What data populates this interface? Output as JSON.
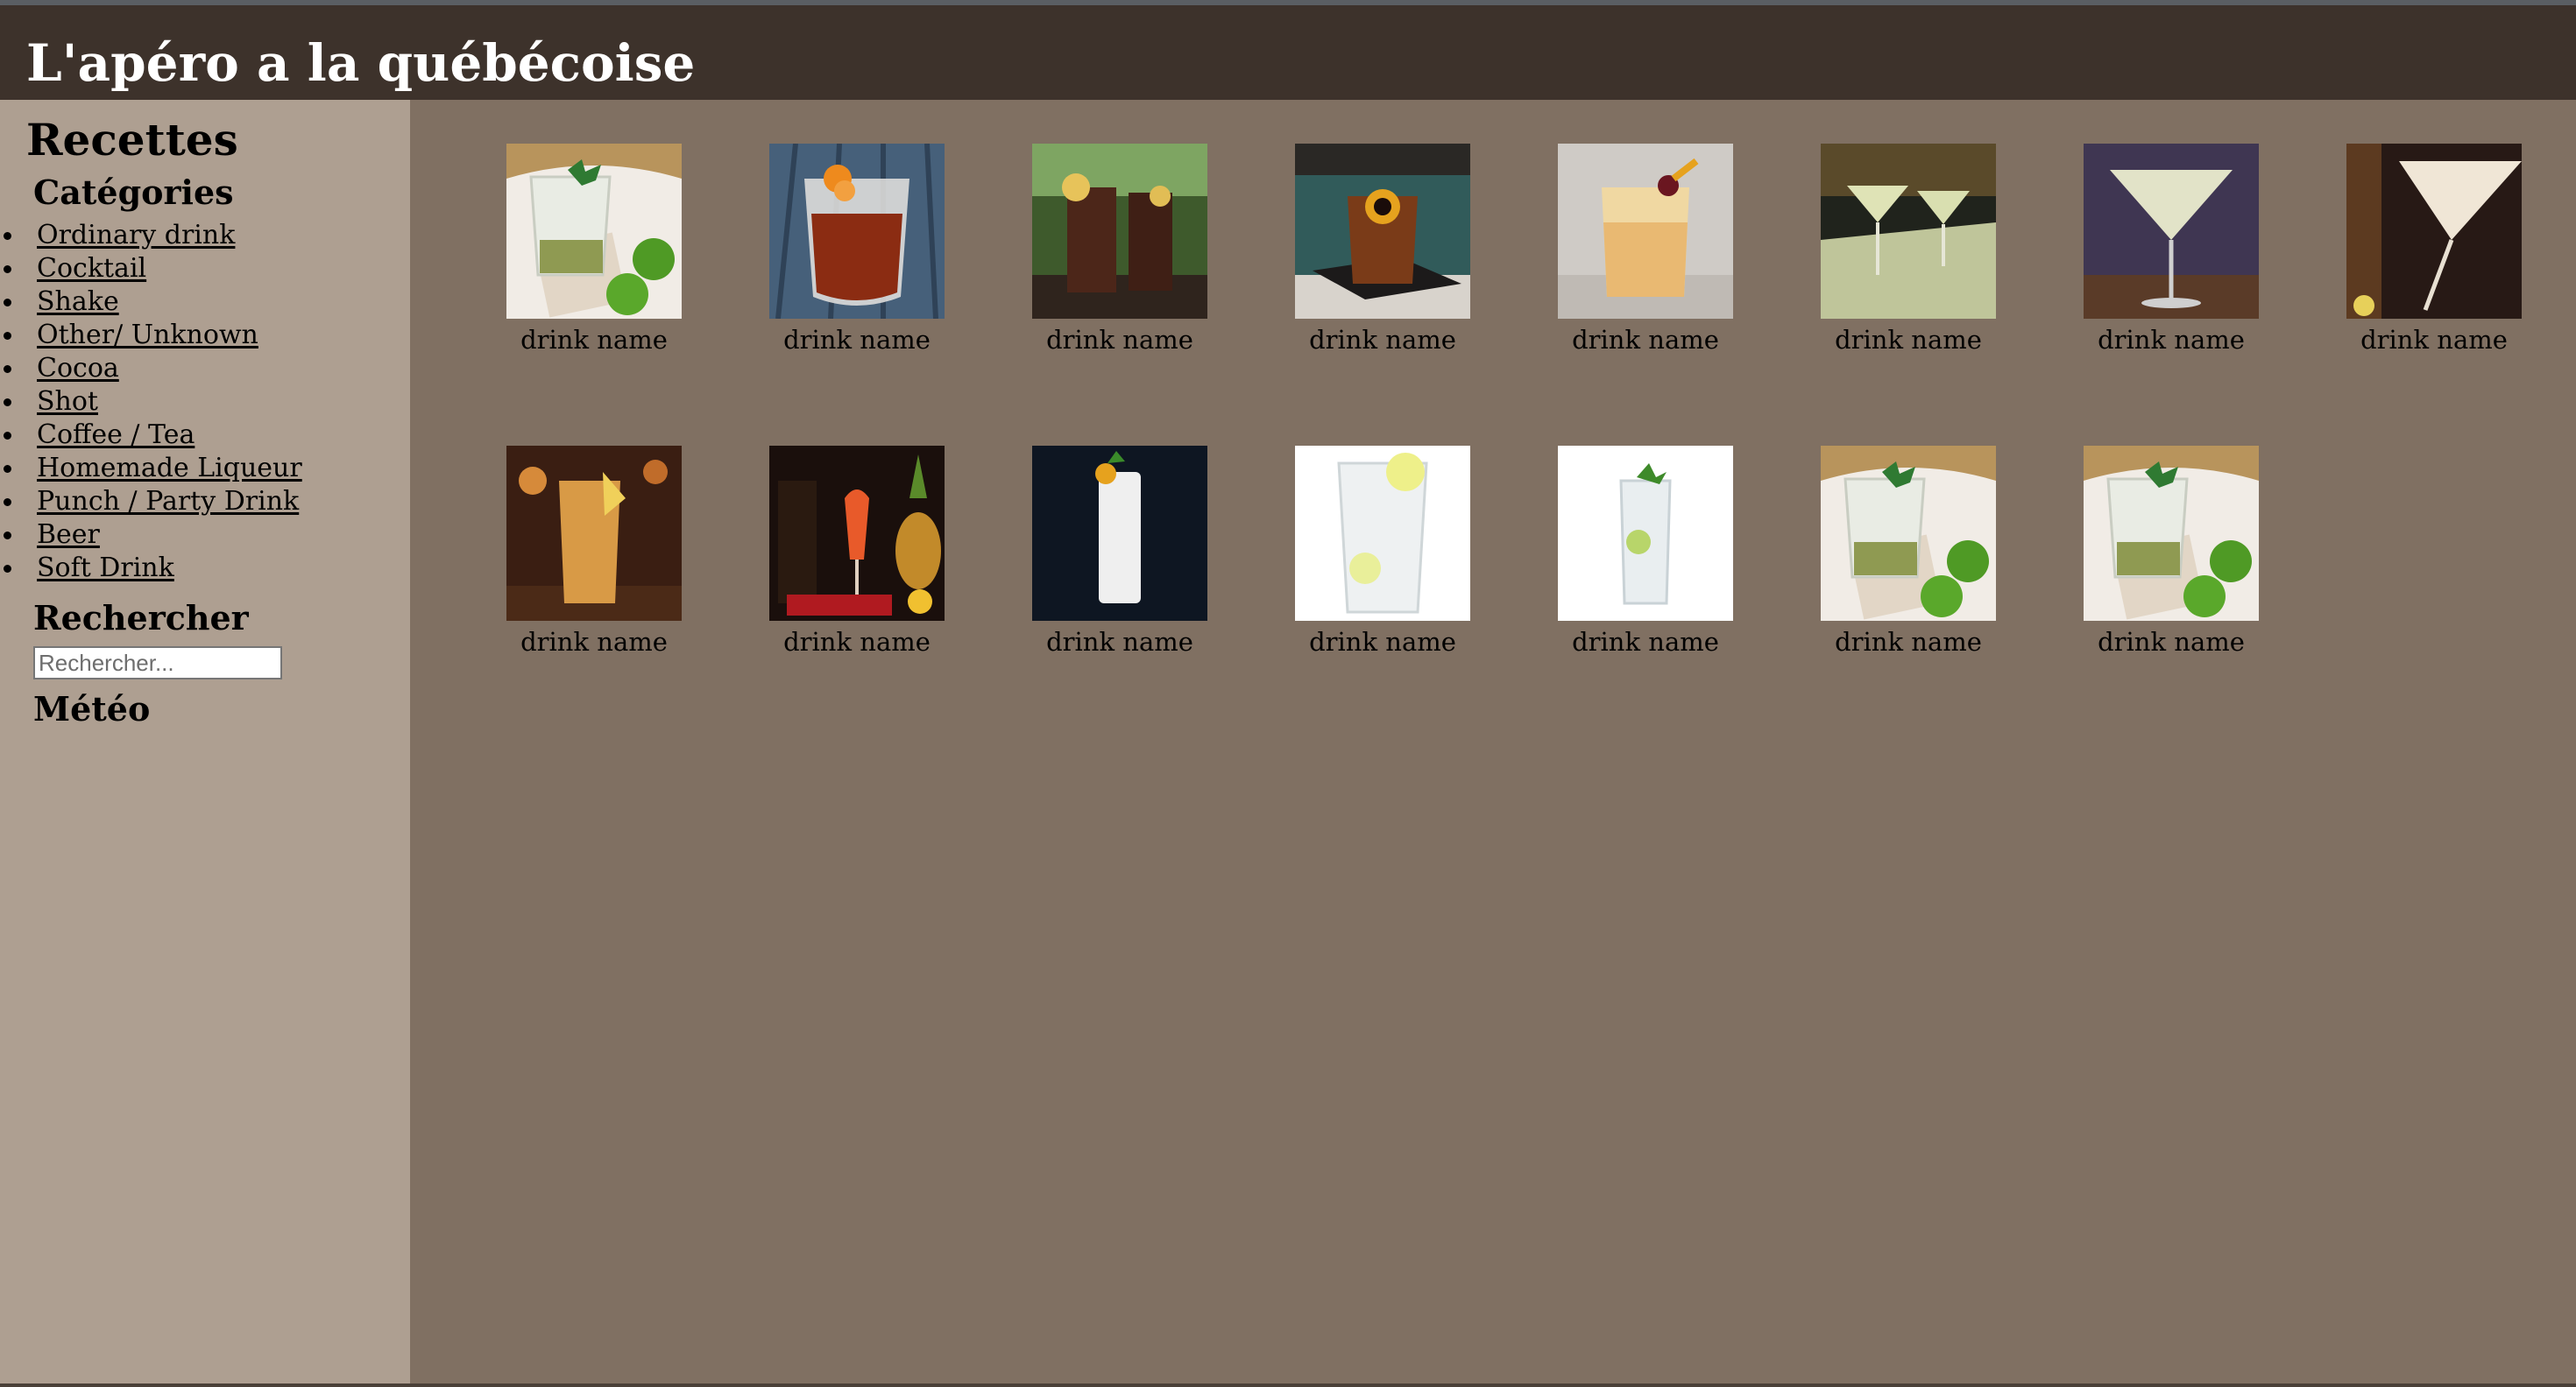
{
  "header": {
    "title": "L'apéro a la québécoise"
  },
  "sidebar": {
    "heading": "Recettes",
    "categories_title": "Catégories",
    "categories": [
      "Ordinary drink",
      "Cocktail",
      "Shake",
      "Other/ Unknown",
      "Cocoa",
      "Shot",
      "Coffee / Tea",
      "Homemade Liqueur",
      "Punch / Party Drink",
      "Beer",
      "Soft Drink"
    ],
    "search_title": "Rechercher",
    "search_placeholder": "Rechercher...",
    "weather_title": "Météo"
  },
  "drinks": [
    {
      "name": "drink name",
      "image": "mojito-mint-lime"
    },
    {
      "name": "drink name",
      "image": "negroni-orange"
    },
    {
      "name": "drink name",
      "image": "iced-tea-lemon"
    },
    {
      "name": "drink name",
      "image": "old-fashioned-cherry"
    },
    {
      "name": "drink name",
      "image": "whiskey-sour-cherry"
    },
    {
      "name": "drink name",
      "image": "two-martinis"
    },
    {
      "name": "drink name",
      "image": "margarita-coupe"
    },
    {
      "name": "drink name",
      "image": "cream-cocktail"
    },
    {
      "name": "drink name",
      "image": "long-island-lemon"
    },
    {
      "name": "drink name",
      "image": "tropical-punch-pineapple"
    },
    {
      "name": "drink name",
      "image": "white-highball"
    },
    {
      "name": "drink name",
      "image": "lemonade-glass"
    },
    {
      "name": "drink name",
      "image": "gin-tonic-lime"
    },
    {
      "name": "drink name",
      "image": "mojito-mint-lime"
    },
    {
      "name": "drink name",
      "image": "mojito-mint-lime"
    }
  ],
  "colors": {
    "header_bg": "#3d322b",
    "sidebar_bg": "#ae9f91",
    "main_bg": "#807062"
  }
}
